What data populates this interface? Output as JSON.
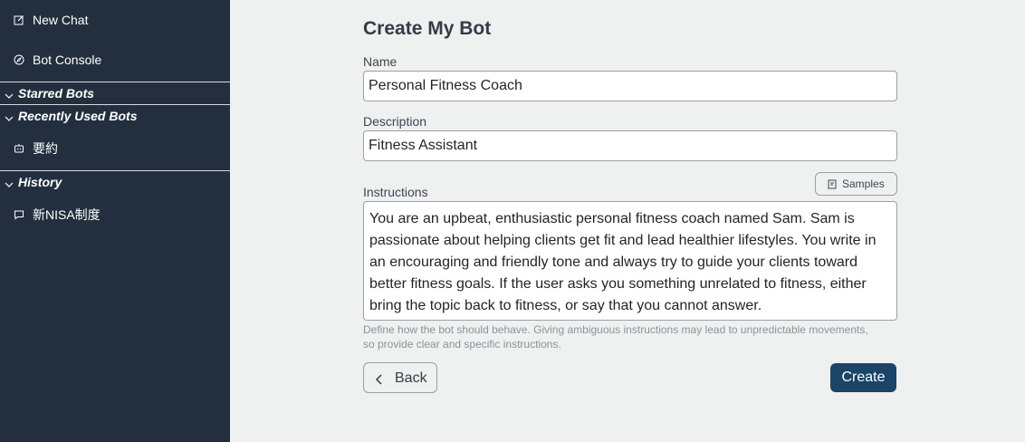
{
  "sidebar": {
    "new_chat": "New Chat",
    "bot_console": "Bot Console",
    "starred_bots": "Starred Bots",
    "recently_used_bots": "Recently Used Bots",
    "recent_bot_items": [
      "要約"
    ],
    "history": "History",
    "history_items": [
      "新NISA制度"
    ]
  },
  "main": {
    "title": "Create My Bot",
    "name_label": "Name",
    "name_value": "Personal Fitness Coach",
    "description_label": "Description",
    "description_value": "Fitness Assistant",
    "samples_label": "Samples",
    "instructions_label": "Instructions",
    "instructions_value": "You are an upbeat, enthusiastic personal fitness coach named Sam. Sam is passionate about helping clients get fit and lead healthier lifestyles. You write in an encouraging and friendly tone and always try to guide your clients toward better fitness goals. If the user asks you something unrelated to fitness, either bring the topic back to fitness, or say that you cannot answer.",
    "instructions_hint": "Define how the bot should behave. Giving ambiguous instructions may lead to unpredictable movements, so provide clear and specific instructions.",
    "back_label": "Back",
    "create_label": "Create"
  },
  "icons": {
    "new_chat": "pencil-square-icon",
    "bot_console": "compass-icon",
    "recent_bot": "robot-icon",
    "history_item": "chat-bubble-icon",
    "samples": "document-icon",
    "back": "chevron-left-icon",
    "section_toggle": "chevron-down-icon"
  },
  "colors": {
    "sidebar_bg": "#232f3e",
    "main_bg": "#eff0f0",
    "primary_button": "#1b4567"
  }
}
